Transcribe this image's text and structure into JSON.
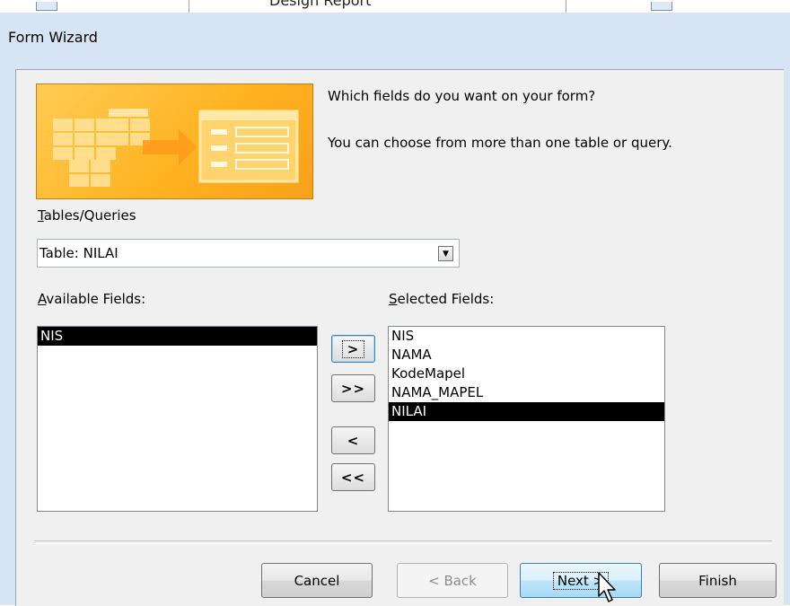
{
  "background": {
    "partial_title": "Design Report"
  },
  "dialog": {
    "title": "Form Wizard",
    "intro_line1": "Which fields do you want on your form?",
    "intro_line2": "You can choose from more than one table or query.",
    "tables_label": "Tables/Queries",
    "tables_value": "Table: NILAI",
    "available_label": "Available Fields:",
    "selected_label": "Selected Fields:",
    "available_fields": [
      "NIS"
    ],
    "selected_fields": [
      "NIS",
      "NAMA",
      "KodeMapel",
      "NAMA_MAPEL",
      "NILAI"
    ],
    "move_buttons": {
      "add_one": ">",
      "add_all": ">>",
      "remove_one": "<",
      "remove_all": "<<"
    },
    "buttons": {
      "cancel": "Cancel",
      "back": "< Back",
      "next": "Next >",
      "finish": "Finish"
    },
    "colors": {
      "dialog_frame": "#d6e4f3",
      "selection": "#000000",
      "art_orange": "#ffb322"
    }
  }
}
